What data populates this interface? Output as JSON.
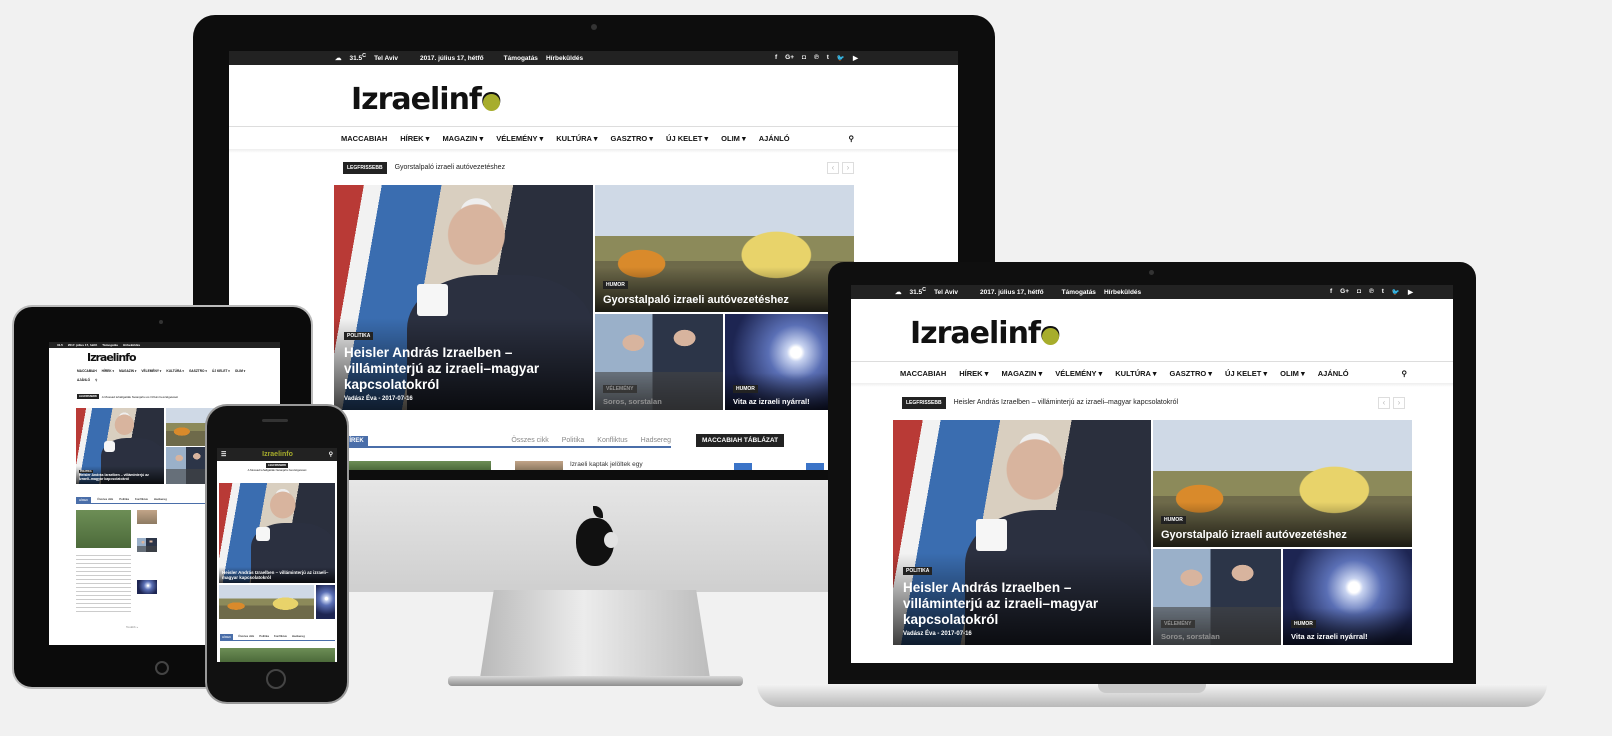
{
  "topbar": {
    "temp": "31.5",
    "unit": "C",
    "city": "Tel Aviv",
    "date": "2017. július 17, hétfő",
    "link1": "Támogatás",
    "link2": "Hírbeküldés"
  },
  "social": [
    "f",
    "G+",
    "◘",
    "℗",
    "t",
    "🐦",
    "▶"
  ],
  "logo": {
    "text": "Izraelinf",
    "last": "o"
  },
  "menu": [
    "MACCABIAH",
    "HÍREK ▾",
    "MAGAZIN ▾",
    "VÉLEMÉNY ▾",
    "KULTÚRA ▾",
    "GASZTRO ▾",
    "ÚJ KELET ▾",
    "OLIM ▾",
    "AJÁNLÓ"
  ],
  "ticker": {
    "badge": "LEGFRISSEBB",
    "imac_text": "Gyorstalpaló izraeli autóvezetéshez",
    "laptop_text": "Heisler András Izraelben – villáminterjú az izraeli–magyar kapcsolatokról",
    "prev": "‹",
    "next": "›"
  },
  "featured": {
    "main": {
      "cat": "POLITIKA",
      "title": "Heisler András Izraelben – villáminterjú az izraeli–magyar kapcsolatokról",
      "author": "Vadász Éva",
      "sep": " - ",
      "date_imac": "2017-07-16",
      "date_laptop": "2017-07-16"
    },
    "right_top": {
      "cat": "HUMOR",
      "title": "Gyorstalpaló izraeli autóvezetéshez"
    },
    "bl": {
      "cat": "VÉLEMÉNY",
      "title": "Soros, sorstalan"
    },
    "br": {
      "cat": "HUMOR",
      "title": "Vita az izraeli nyárral!"
    }
  },
  "section": {
    "label": "HÍREK",
    "tabs": [
      "Összes cikk",
      "Politika",
      "Konfliktus",
      "Hadsereg"
    ],
    "sidebar_title": "MACCABIAH TÁBLÁZAT",
    "snippet": "Izraeli kaptak jelöltek egy"
  },
  "tablet": {
    "ticker": "A Mossad lehallgatták Netanjahu és Orbán beszélgetését",
    "more": "Tovább »",
    "tabs": [
      "Összes cikk",
      "Politika",
      "Konfliktus",
      "Hadsereg"
    ],
    "label": "HÍREK"
  },
  "phone": {
    "ticker": "A Mossad lehallgatták Netanjahu beszélgetését",
    "title": "Heisler András Izraelben – villáminterjú az izraeli–magyar kapcsolatokról",
    "label": "HÍREK",
    "tabs": [
      "Összes cikk",
      "Politika",
      "Konfliktus",
      "Hadsereg"
    ]
  }
}
